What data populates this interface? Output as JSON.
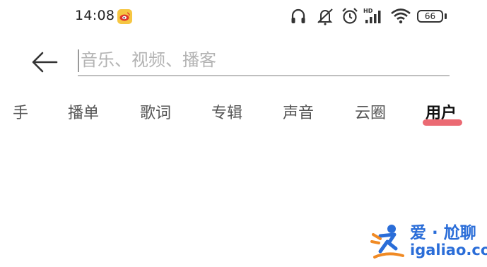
{
  "status_bar": {
    "time": "14:08",
    "battery": "66",
    "network_label": "HD",
    "icons": [
      "weibo-icon",
      "headphones-icon",
      "mute-icon",
      "alarm-icon",
      "signal-icon",
      "wifi-icon",
      "battery-icon"
    ]
  },
  "search": {
    "placeholder": "音乐、视频、播客",
    "value": ""
  },
  "tabs": [
    {
      "label": "手",
      "active": false
    },
    {
      "label": "播单",
      "active": false
    },
    {
      "label": "歌词",
      "active": false
    },
    {
      "label": "专辑",
      "active": false
    },
    {
      "label": "声音",
      "active": false
    },
    {
      "label": "云圈",
      "active": false
    },
    {
      "label": "用户",
      "active": true
    }
  ],
  "colors": {
    "accent": "#e8505b",
    "watermark": "#2a6dd8",
    "weibo_badge": "#f6c642"
  },
  "watermark": {
    "title": "爱 · 尬聊",
    "url": "igaliao.com"
  }
}
